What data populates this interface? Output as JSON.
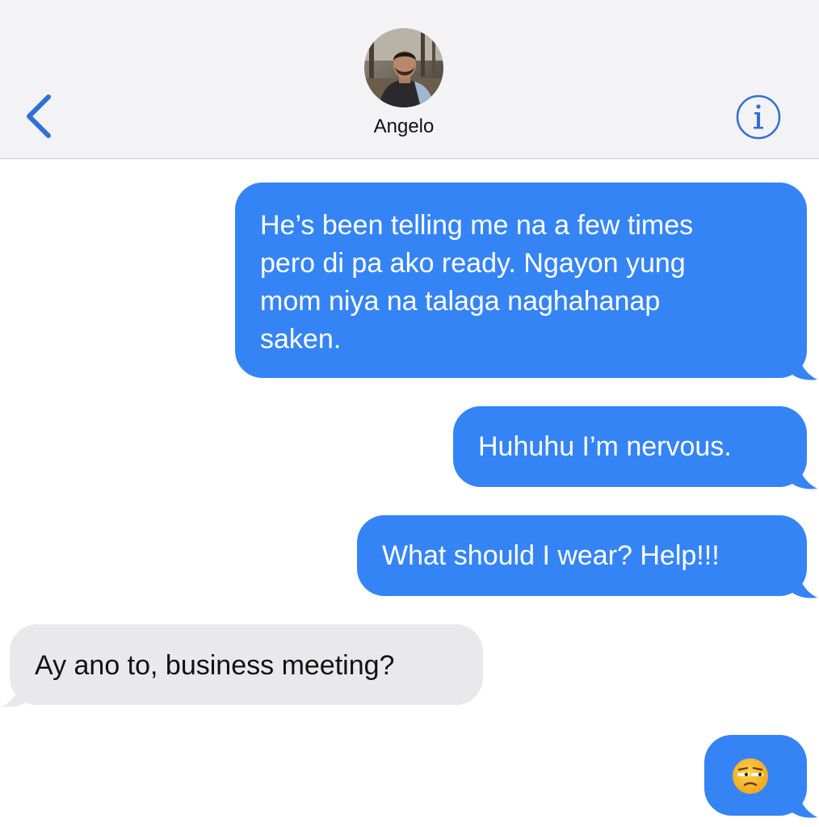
{
  "header": {
    "contact_name": "Angelo",
    "back_icon": "chevron-left-icon",
    "info_icon": "info-icon",
    "accent_color": "#2f6fd8"
  },
  "messages": [
    {
      "direction": "outgoing",
      "text": "He’s been telling me na a few times\npero di pa ako ready. Ngayon yung\nmom niya na talaga naghahanap\nsaken."
    },
    {
      "direction": "outgoing",
      "text": "Huhuhu I’m nervous."
    },
    {
      "direction": "outgoing",
      "text": "What should I wear? Help!!!"
    },
    {
      "direction": "incoming",
      "text": "Ay ano to, business meeting?"
    },
    {
      "direction": "outgoing",
      "text": "😒",
      "emoji_name": "unamused-face-emoji"
    }
  ],
  "colors": {
    "outgoing_bubble": "#3584f6",
    "incoming_bubble": "#e9e9eb",
    "header_background": "#f3f2f4"
  }
}
